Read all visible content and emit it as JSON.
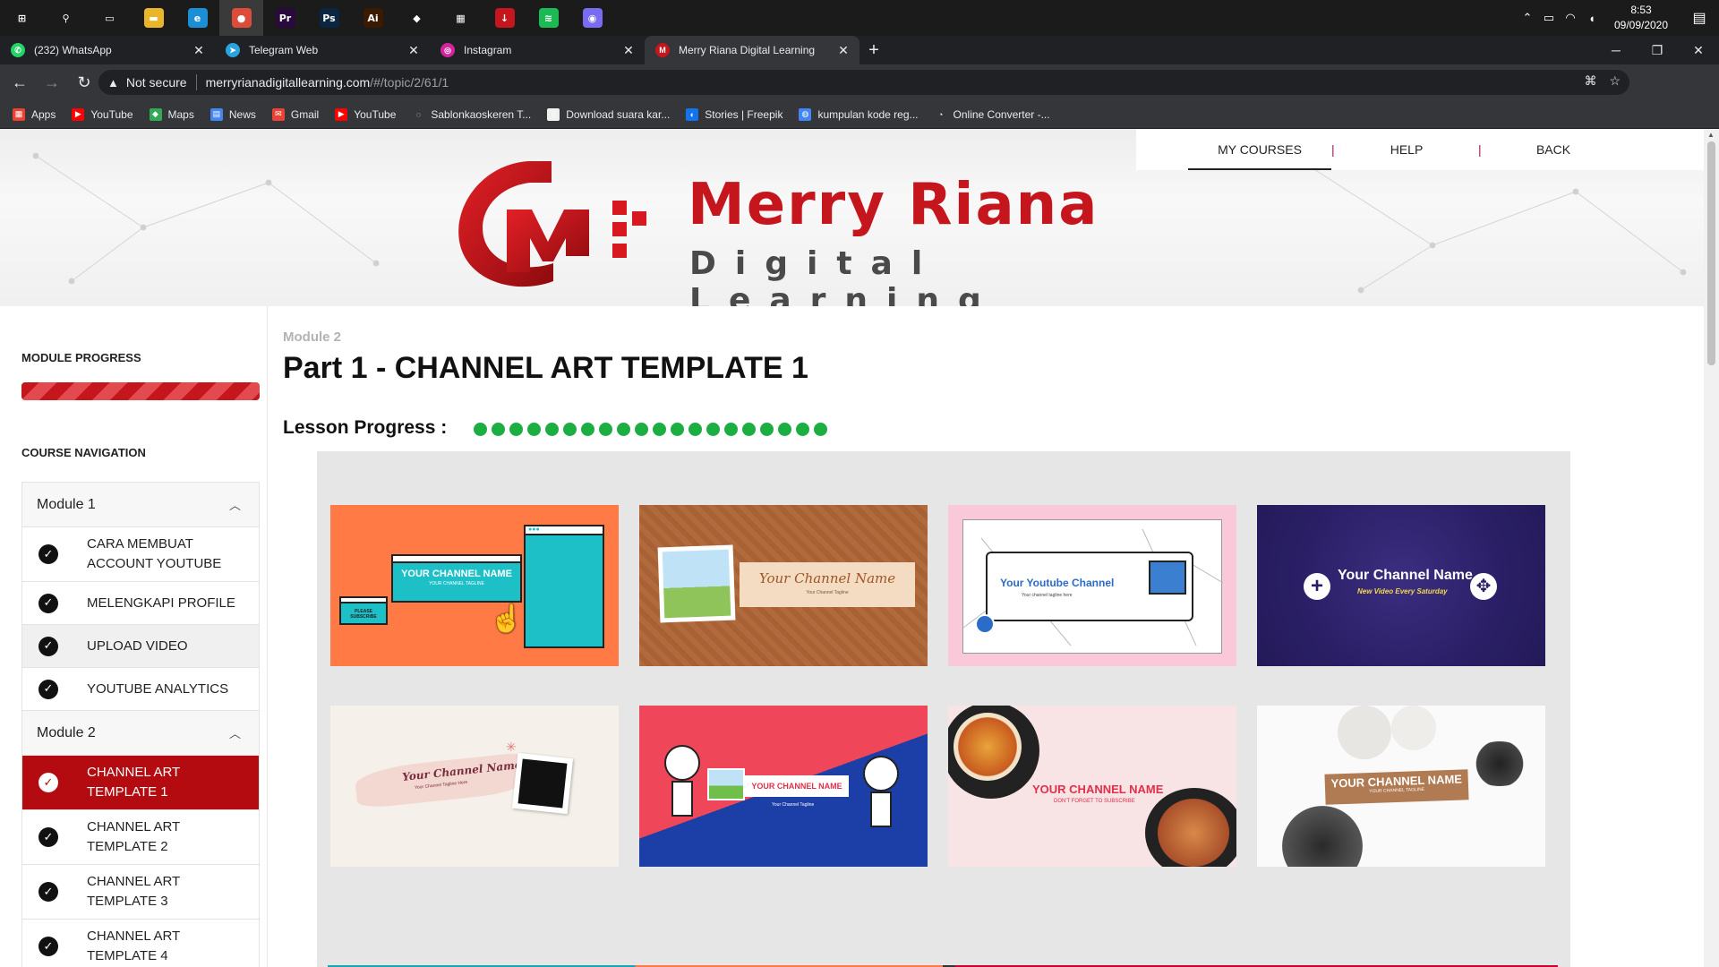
{
  "taskbar": {
    "apps": [
      {
        "name": "windows-start",
        "label": "⊞",
        "color": "#1b1b1b"
      },
      {
        "name": "search",
        "label": "⚲",
        "color": "#1b1b1b"
      },
      {
        "name": "task-view",
        "label": "▭",
        "color": "#1b1b1b"
      },
      {
        "name": "file-explorer",
        "label": "▬",
        "color": "#e8b628"
      },
      {
        "name": "edge",
        "label": "e",
        "color": "#1b8fd6"
      },
      {
        "name": "chrome",
        "label": "●",
        "color": "#dd4b39"
      },
      {
        "name": "premiere",
        "label": "Pr",
        "color": "#2a0a3d"
      },
      {
        "name": "photoshop",
        "label": "Ps",
        "color": "#0b2642"
      },
      {
        "name": "illustrator",
        "label": "Ai",
        "color": "#3a1a00"
      },
      {
        "name": "filmora",
        "label": "◆",
        "color": "#1b1b1b"
      },
      {
        "name": "clapper",
        "label": "▦",
        "color": "#1b1b1b"
      },
      {
        "name": "downloader",
        "label": "↓",
        "color": "#c4161c"
      },
      {
        "name": "spotify",
        "label": "≋",
        "color": "#1db954"
      },
      {
        "name": "game",
        "label": "◉",
        "color": "#7a6cf0"
      }
    ],
    "clock_time": "8:53",
    "clock_date": "09/09/2020"
  },
  "browser": {
    "tabs": [
      {
        "title": "(232) WhatsApp",
        "fav_color": "#25d366",
        "fav": "✆",
        "active": false
      },
      {
        "title": "Telegram Web",
        "fav_color": "#2aa3de",
        "fav": "➤",
        "active": false
      },
      {
        "title": "Instagram",
        "fav_color": "#d6249f",
        "fav": "◎",
        "active": false
      },
      {
        "title": "Merry Riana Digital Learning",
        "fav_color": "#c4161c",
        "fav": "M",
        "active": true
      }
    ],
    "new_tab": "+",
    "not_secure": "Not secure",
    "url_host": "merryrianadigitallearning.com",
    "url_path": "/#/topic/2/61/1",
    "bookmarks": [
      {
        "label": "Apps",
        "color": "#e94235",
        "icon": "▦"
      },
      {
        "label": "YouTube",
        "color": "#ff0000",
        "icon": "▶"
      },
      {
        "label": "Maps",
        "color": "#34a853",
        "icon": "◆"
      },
      {
        "label": "News",
        "color": "#4285f4",
        "icon": "▤"
      },
      {
        "label": "Gmail",
        "color": "#ea4335",
        "icon": "✉"
      },
      {
        "label": "YouTube",
        "color": "#ff0000",
        "icon": "▶"
      },
      {
        "label": "Sablonkaoskeren T...",
        "color": "#35363a",
        "icon": "◌"
      },
      {
        "label": "Download suara kar...",
        "color": "#f0f0f0",
        "icon": "▯"
      },
      {
        "label": "Stories | Freepik",
        "color": "#1273eb",
        "icon": "◐"
      },
      {
        "label": "kumpulan kode reg...",
        "color": "#4285f4",
        "icon": "◍"
      },
      {
        "label": "Online Converter -...",
        "color": "#35363a",
        "icon": "◔"
      }
    ]
  },
  "header": {
    "logo_line1": "Merry Riana",
    "logo_line2": "Digital Learning",
    "nav": {
      "my_courses": "MY COURSES",
      "divider": "|",
      "help": "HELP",
      "back": "BACK"
    }
  },
  "sidebar": {
    "module_progress_label": "MODULE PROGRESS",
    "course_nav_label": "COURSE NAVIGATION",
    "modules": [
      {
        "title": "Module 1",
        "items": [
          {
            "label": "CARA MEMBUAT ACCOUNT YOUTUBE",
            "tall": true,
            "state": "normal"
          },
          {
            "label": "MELENGKAPI PROFILE",
            "tall": false,
            "state": "normal"
          },
          {
            "label": "UPLOAD VIDEO",
            "tall": false,
            "state": "highlight"
          },
          {
            "label": "YOUTUBE ANALYTICS",
            "tall": false,
            "state": "normal"
          }
        ]
      },
      {
        "title": "Module 2",
        "items": [
          {
            "label": "CHANNEL ART TEMPLATE 1",
            "tall": true,
            "state": "active"
          },
          {
            "label": "CHANNEL ART TEMPLATE 2",
            "tall": true,
            "state": "normal"
          },
          {
            "label": "CHANNEL ART TEMPLATE 3",
            "tall": true,
            "state": "normal"
          },
          {
            "label": "CHANNEL ART TEMPLATE 4",
            "tall": true,
            "state": "normal"
          }
        ]
      }
    ]
  },
  "main": {
    "module_label": "Module 2",
    "title": "Part 1 - CHANNEL ART TEMPLATE 1",
    "lesson_progress_label": "Lesson Progress :",
    "lesson_progress_steps_completed": 20,
    "lesson_progress_steps_total": 20
  },
  "templates": {
    "t1": {
      "name": "YOUR CHANNEL NAME",
      "tagline": "YOUR CHANNEL TAGLINE",
      "subscribe": "PLEASE SUBSCRIBE"
    },
    "t2": {
      "name": "Your Channel Name",
      "tagline": "Your Channel Tagline"
    },
    "t3": {
      "name": "Your Youtube Channel",
      "tagline": "Your channel tagline here"
    },
    "t4": {
      "name": "Your Channel Name",
      "tagline": "New Video Every Saturday"
    },
    "t5": {
      "name": "Your Channel Name",
      "tagline": "Your Channel Tagline Here"
    },
    "t6": {
      "name": "YOUR CHANNEL NAME",
      "tagline": "Your Channel Tagline"
    },
    "t7": {
      "name": "YOUR CHANNEL NAME",
      "tagline": "DON'T FORGET TO SUBSCRIBE"
    },
    "t8": {
      "name": "YOUR CHANNEL NAME",
      "tagline": "YOUR CHANNEL TAGLINE"
    }
  },
  "colors": {
    "brand_red": "#c4161c",
    "active_nav": "#b30b10",
    "progress_green": "#1cae43"
  }
}
